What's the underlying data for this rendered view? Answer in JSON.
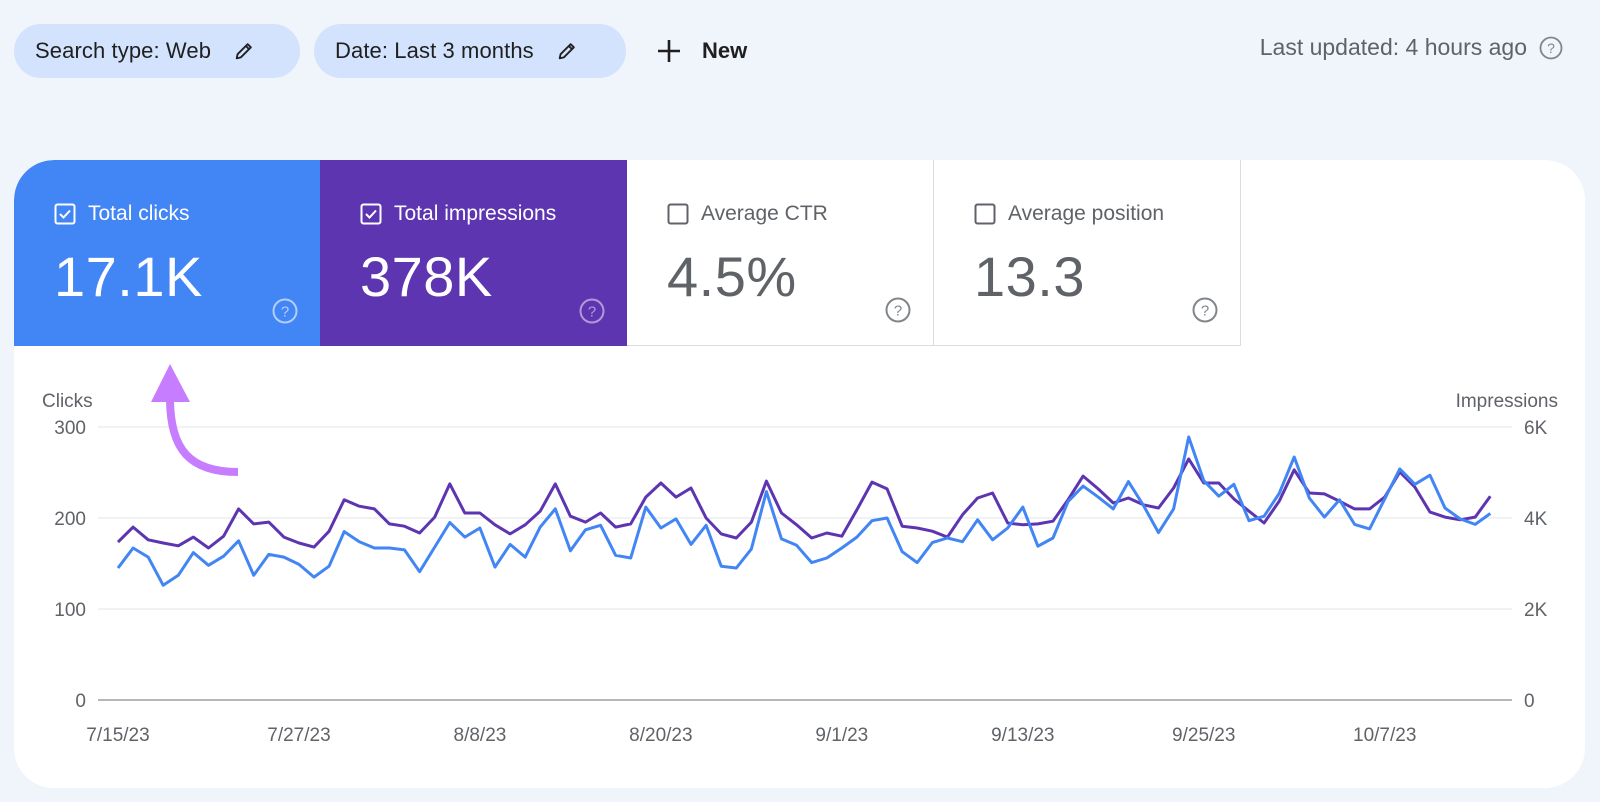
{
  "filters": {
    "search_type": "Search type: Web",
    "date": "Date: Last 3 months",
    "new_label": "New"
  },
  "status": {
    "last_updated": "Last updated: 4 hours ago"
  },
  "metrics": [
    {
      "title": "Total clicks",
      "value": "17.1K",
      "checked": true,
      "color": "#4285f4"
    },
    {
      "title": "Total impressions",
      "value": "378K",
      "checked": true,
      "color": "#5e35b1"
    },
    {
      "title": "Average CTR",
      "value": "4.5%",
      "checked": false
    },
    {
      "title": "Average position",
      "value": "13.3",
      "checked": false
    }
  ],
  "annotation": {
    "icon": "curved-arrow-up-icon",
    "color": "#c77dff"
  },
  "chart_data": {
    "type": "line",
    "left_axis_label": "Clicks",
    "right_axis_label": "Impressions",
    "left_ticks": [
      "300",
      "200",
      "100",
      "0"
    ],
    "right_ticks": [
      "6K",
      "4K",
      "2K",
      "0"
    ],
    "left_ylim": [
      0,
      300
    ],
    "right_ylim": [
      0,
      6000
    ],
    "x_tick_labels": [
      "7/15/23",
      "7/27/23",
      "8/8/23",
      "8/20/23",
      "9/1/23",
      "9/13/23",
      "9/25/23",
      "10/7/23"
    ],
    "x_tick_index": [
      0,
      12,
      24,
      36,
      48,
      60,
      72,
      84
    ],
    "grid": true,
    "x": [
      "7/15/23",
      "7/16/23",
      "7/17/23",
      "7/18/23",
      "7/19/23",
      "7/20/23",
      "7/21/23",
      "7/22/23",
      "7/23/23",
      "7/24/23",
      "7/25/23",
      "7/26/23",
      "7/27/23",
      "7/28/23",
      "7/29/23",
      "7/30/23",
      "7/31/23",
      "8/1/23",
      "8/2/23",
      "8/3/23",
      "8/4/23",
      "8/5/23",
      "8/6/23",
      "8/7/23",
      "8/8/23",
      "8/9/23",
      "8/10/23",
      "8/11/23",
      "8/12/23",
      "8/13/23",
      "8/14/23",
      "8/15/23",
      "8/16/23",
      "8/17/23",
      "8/18/23",
      "8/19/23",
      "8/20/23",
      "8/21/23",
      "8/22/23",
      "8/23/23",
      "8/24/23",
      "8/25/23",
      "8/26/23",
      "8/27/23",
      "8/28/23",
      "8/29/23",
      "8/30/23",
      "8/31/23",
      "9/1/23",
      "9/2/23",
      "9/3/23",
      "9/4/23",
      "9/5/23",
      "9/6/23",
      "9/7/23",
      "9/8/23",
      "9/9/23",
      "9/10/23",
      "9/11/23",
      "9/12/23",
      "9/13/23",
      "9/14/23",
      "9/15/23",
      "9/16/23",
      "9/17/23",
      "9/18/23",
      "9/19/23",
      "9/20/23",
      "9/21/23",
      "9/22/23",
      "9/23/23",
      "9/24/23",
      "9/25/23",
      "9/26/23",
      "9/27/23",
      "9/28/23",
      "9/29/23",
      "9/30/23",
      "10/1/23",
      "10/2/23",
      "10/3/23",
      "10/4/23",
      "10/5/23",
      "10/6/23",
      "10/7/23",
      "10/8/23",
      "10/9/23",
      "10/10/23",
      "10/11/23",
      "10/12/23",
      "10/13/23",
      "10/14/23"
    ],
    "series": [
      {
        "name": "Clicks",
        "axis": "left",
        "color": "#4285f4",
        "values": [
          145,
          167,
          157,
          126,
          137,
          162,
          148,
          158,
          175,
          137,
          160,
          157,
          149,
          135,
          147,
          185,
          174,
          167,
          167,
          165,
          141,
          168,
          195,
          179,
          189,
          146,
          171,
          157,
          190,
          210,
          164,
          187,
          192,
          159,
          156,
          212,
          189,
          199,
          171,
          192,
          147,
          145,
          166,
          229,
          177,
          170,
          151,
          156,
          167,
          179,
          197,
          200,
          163,
          151,
          173,
          178,
          174,
          198,
          176,
          189,
          212,
          169,
          178,
          218,
          235,
          223,
          210,
          240,
          214,
          184,
          210,
          289,
          241,
          224,
          237,
          197,
          202,
          227,
          267,
          222,
          201,
          220,
          193,
          188,
          221,
          254,
          237,
          247,
          211,
          199,
          193,
          205
        ]
      },
      {
        "name": "Impressions",
        "axis": "right",
        "color": "#5e35b1",
        "values": [
          3470,
          3800,
          3520,
          3450,
          3390,
          3580,
          3340,
          3600,
          4200,
          3870,
          3910,
          3580,
          3450,
          3360,
          3710,
          4400,
          4260,
          4200,
          3870,
          3820,
          3670,
          4020,
          4750,
          4110,
          4110,
          3850,
          3650,
          3850,
          4150,
          4750,
          4040,
          3910,
          4110,
          3800,
          3870,
          4460,
          4770,
          4460,
          4660,
          4000,
          3650,
          3560,
          3910,
          4810,
          4110,
          3850,
          3560,
          3670,
          3600,
          4180,
          4790,
          4640,
          3820,
          3780,
          3710,
          3580,
          4070,
          4440,
          4550,
          3890,
          3850,
          3870,
          3930,
          4400,
          4920,
          4640,
          4330,
          4440,
          4290,
          4220,
          4660,
          5300,
          4770,
          4770,
          4420,
          4150,
          3890,
          4370,
          5060,
          4550,
          4530,
          4370,
          4200,
          4200,
          4460,
          5010,
          4680,
          4130,
          4020,
          3960,
          4020,
          4480
        ]
      }
    ]
  }
}
